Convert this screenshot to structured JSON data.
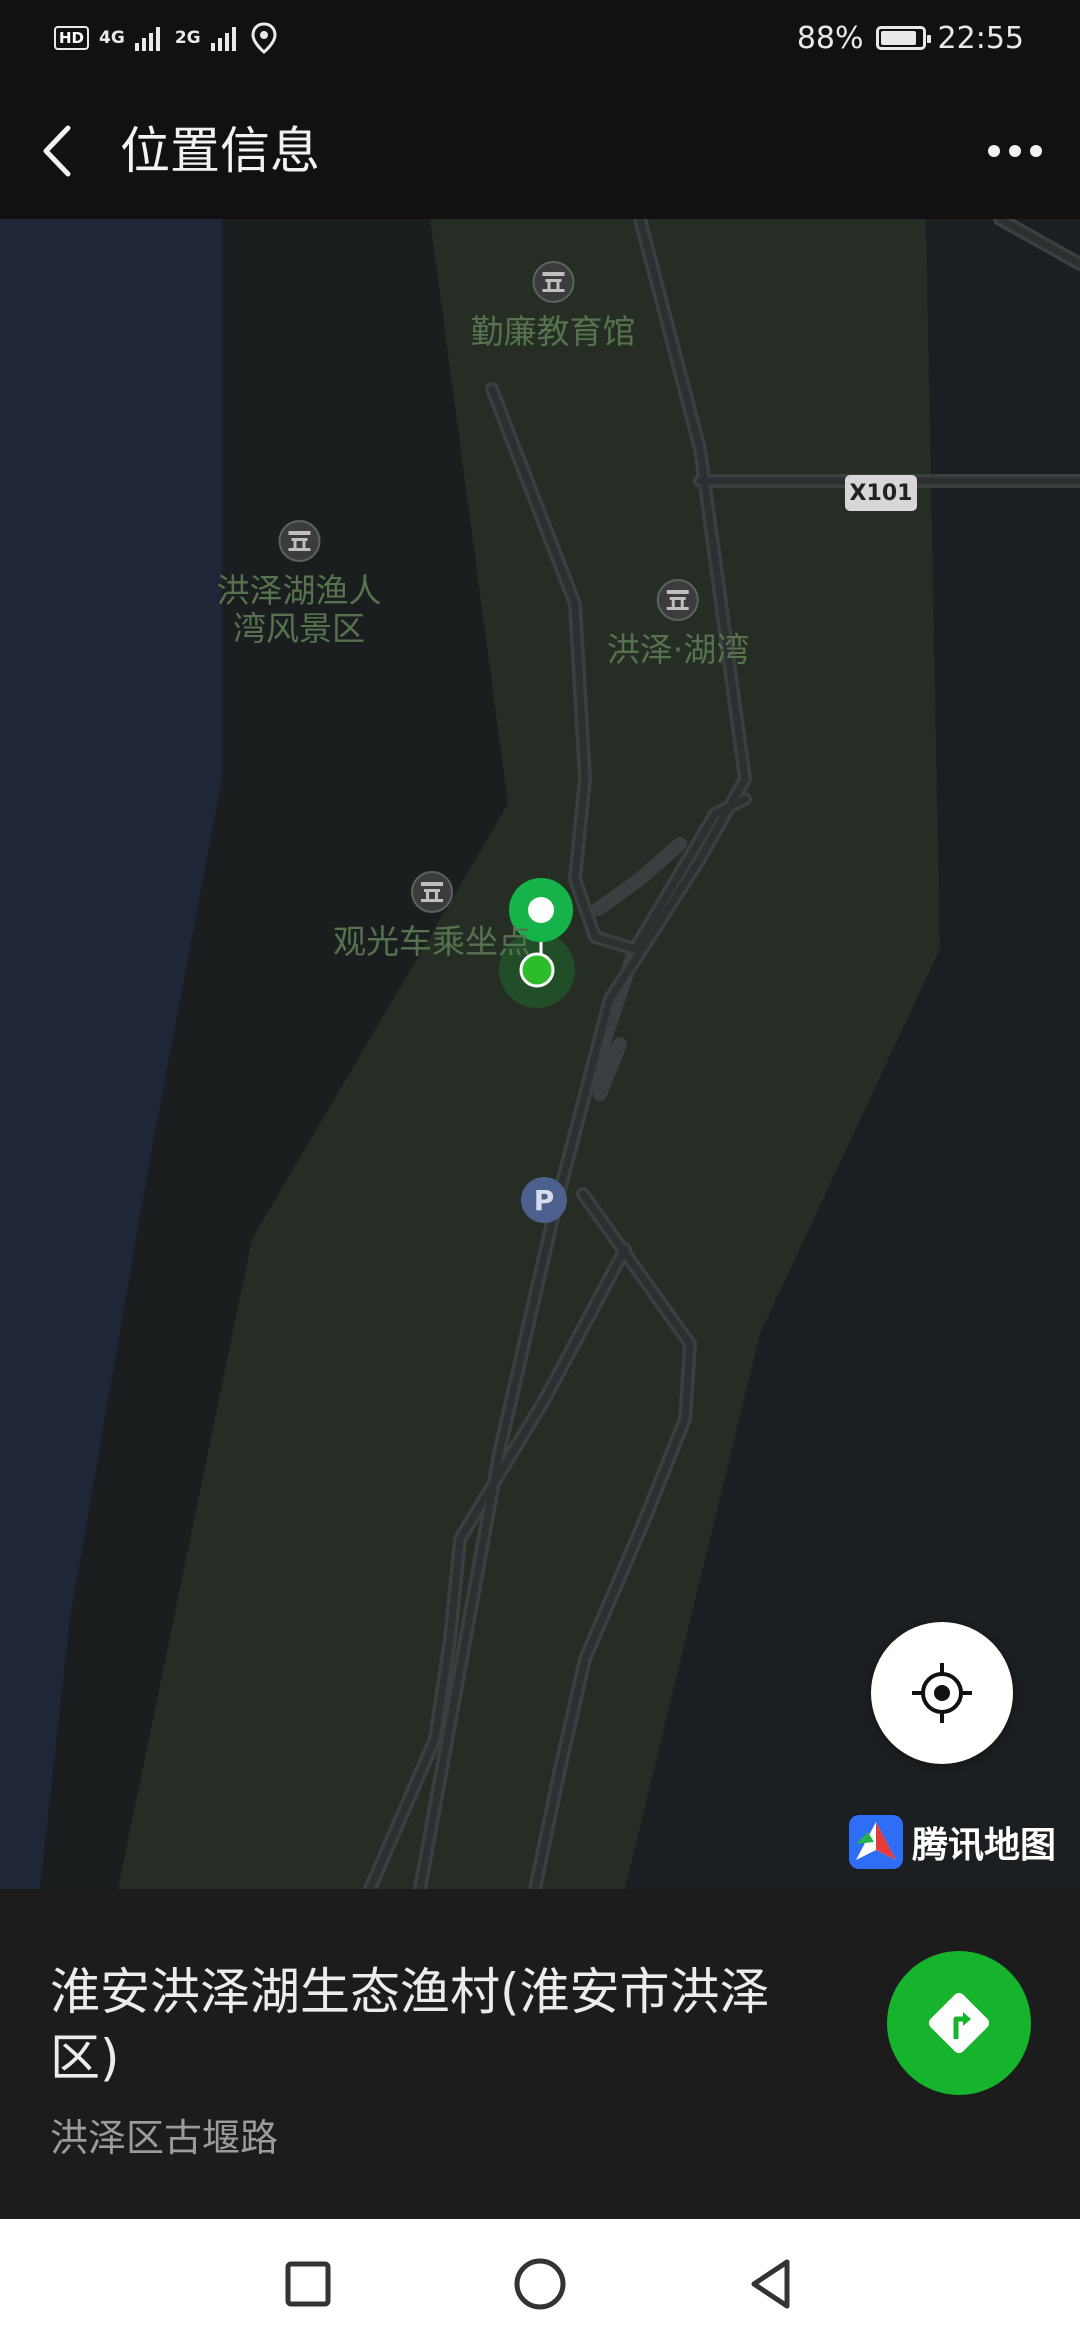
{
  "status_bar": {
    "hd": "HD",
    "network_1": "4G",
    "network_2": "2G",
    "battery_percent": "88%",
    "battery_level": 0.88,
    "time": "22:55"
  },
  "header": {
    "title": "位置信息",
    "back_icon": "chevron-left-icon",
    "more_icon": "more-horizontal-icon"
  },
  "map": {
    "pois": [
      {
        "name": "勤廉教育馆"
      },
      {
        "name": "洪泽湖渔人\n湾风景区"
      },
      {
        "name": "洪泽·湖湾"
      },
      {
        "name": "观光车乘坐点"
      }
    ],
    "road_badge": "X101",
    "parking_label": "P",
    "provider": "腾讯地图",
    "colors": {
      "water": "#1e2638",
      "land": "#262d25",
      "road": "#3b3f41",
      "pin": "#16b34a"
    }
  },
  "place": {
    "name": "淮安洪泽湖生态渔村(淮安市洪泽区)",
    "address": "洪泽区古堰路"
  },
  "system_nav": {
    "recent_icon": "square-icon",
    "home_icon": "circle-icon",
    "back_icon": "triangle-back-icon"
  }
}
